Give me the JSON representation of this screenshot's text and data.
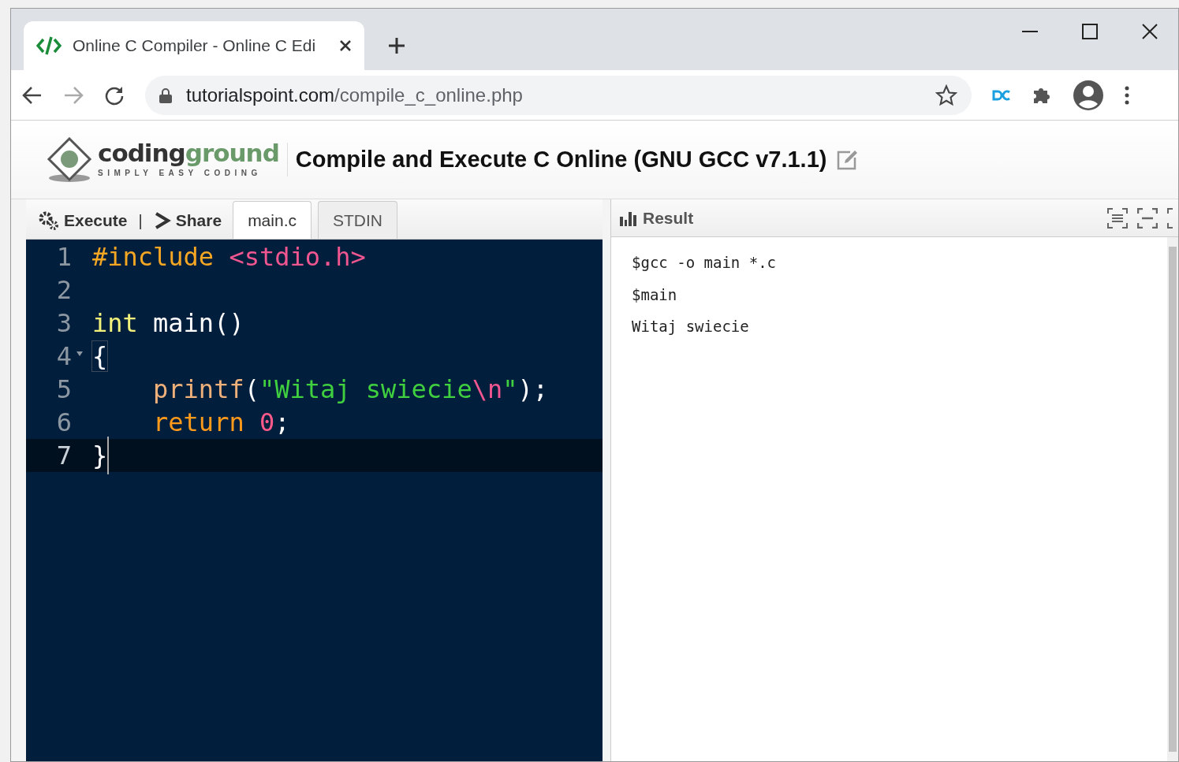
{
  "browser": {
    "tab_title": "Online C Compiler - Online C Edi",
    "url_host": "tutorialspoint.com",
    "url_path": "/compile_c_online.php"
  },
  "header": {
    "logo_word_dark": "coding",
    "logo_word_green": "ground",
    "logo_tagline": "SIMPLY EASY CODING",
    "title": "Compile and Execute C Online (GNU GCC v7.1.1)"
  },
  "toolbar": {
    "actions": [
      {
        "kind": "execute",
        "label": "Execute"
      },
      {
        "kind": "share",
        "label": "Share"
      }
    ],
    "separator": "|",
    "tabs": [
      {
        "label": "main.c",
        "selected": true
      },
      {
        "label": "STDIN",
        "selected": false
      }
    ]
  },
  "editor": {
    "lines": [
      {
        "number": "1",
        "active": false,
        "foldable": false,
        "tokens": [
          {
            "kind": "preproc",
            "text": "#include "
          },
          {
            "kind": "header",
            "text": "<stdio.h>"
          }
        ]
      },
      {
        "number": "2",
        "active": false,
        "foldable": false
      },
      {
        "number": "3",
        "active": false,
        "foldable": false,
        "tokens": [
          {
            "kind": "type",
            "text": "int"
          },
          {
            "kind": "plain",
            "text": " main()"
          }
        ]
      },
      {
        "number": "4",
        "active": false,
        "foldable": true,
        "tokens": [
          {
            "kind": "bracket",
            "text": "{"
          }
        ]
      },
      {
        "number": "5",
        "active": false,
        "foldable": false,
        "tokens": [
          {
            "kind": "function",
            "text": "    printf"
          },
          {
            "kind": "plain",
            "text": "("
          },
          {
            "kind": "string",
            "text": "\"Witaj swiecie"
          },
          {
            "kind": "escape",
            "text": "\\n"
          },
          {
            "kind": "string",
            "text": "\""
          },
          {
            "kind": "plain",
            "text": ");"
          }
        ]
      },
      {
        "number": "6",
        "active": false,
        "foldable": false,
        "tokens": [
          {
            "kind": "keyword",
            "text": "    return "
          },
          {
            "kind": "number",
            "text": "0"
          },
          {
            "kind": "plain",
            "text": ";"
          }
        ]
      },
      {
        "number": "7",
        "active": true,
        "foldable": false,
        "tokens": [
          {
            "kind": "plain",
            "text": "}"
          }
        ]
      }
    ]
  },
  "result": {
    "title": "Result",
    "lines": [
      "$gcc -o main *.c",
      "$main",
      "Witaj swiecie"
    ]
  }
}
